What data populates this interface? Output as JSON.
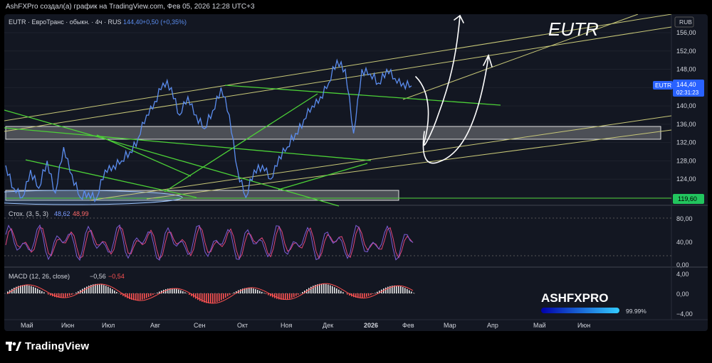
{
  "header": {
    "attribution": "AshFXPro создал(а) график на TradingView.com, Фев 05, 2026 12:28 UTC+3"
  },
  "symbol_bar": {
    "text": "EUTR · ЕвроТранс · обыкн. · 4ч · RUS",
    "last": "144,40",
    "change": "+0,50 (+0,35%)"
  },
  "overlay_title": "EUTR",
  "currency": "RUB",
  "price_axis": [
    "156,00",
    "152,00",
    "148,00",
    "144,00",
    "140,00",
    "136,00",
    "132,00",
    "128,00",
    "124,00",
    "120,00"
  ],
  "price_label": {
    "symbol": "EUTR",
    "price": "144,40",
    "countdown": "02:31:23"
  },
  "level_label": "119,60",
  "stoch": {
    "title": "Стох. (3, 5, 3)",
    "k": "48,62",
    "d": "48,99",
    "axis": [
      "80,00",
      "40,00",
      "0,00"
    ]
  },
  "macd": {
    "title": "MACD (12, 26, close)",
    "v1": "−0,56",
    "v2": "−0,54",
    "axis": [
      "4,00",
      "0,00",
      "−4,00"
    ]
  },
  "time_axis": [
    "Май",
    "Июн",
    "Июл",
    "Авг",
    "Сен",
    "Окт",
    "Ноя",
    "Дек",
    "2026",
    "Фев",
    "Мар",
    "Апр",
    "Май",
    "Июн"
  ],
  "watermark": {
    "brand": "ASHFXPRO",
    "percent": "99.99%"
  },
  "footer": {
    "brand": "TradingView"
  },
  "colors": {
    "background": "#131722",
    "price_line": "#5b8def",
    "channel": "#c8c878",
    "trend": "#4cd137",
    "zone": "#9e9e9e",
    "stoch_k": "#7b5cd6",
    "stoch_d": "#e0457b",
    "macd_hist_pos": "#ffffff",
    "macd_hist_neg": "#ff5252"
  },
  "chart_data": {
    "type": "line",
    "title": "EUTR",
    "y_unit": "RUB",
    "ylim": [
      117,
      158
    ],
    "x": [
      "Апр",
      "Май",
      "Июн",
      "Июл",
      "Авг",
      "Сен",
      "Окт",
      "Ноя",
      "Дек",
      "2026",
      "Фев"
    ],
    "series": [
      {
        "values": [
          127,
          122,
          120,
          126,
          122,
          128,
          121,
          131,
          125,
          120,
          121,
          120,
          126,
          127,
          128,
          130,
          133,
          138,
          141,
          145,
          144,
          138,
          142,
          138,
          135,
          139,
          144,
          138,
          126,
          120,
          126,
          127,
          124,
          129,
          131,
          134,
          137,
          140,
          142,
          145,
          150,
          148,
          134,
          148,
          147,
          145,
          148,
          146,
          145,
          144.4
        ]
      }
    ],
    "grid": true
  }
}
